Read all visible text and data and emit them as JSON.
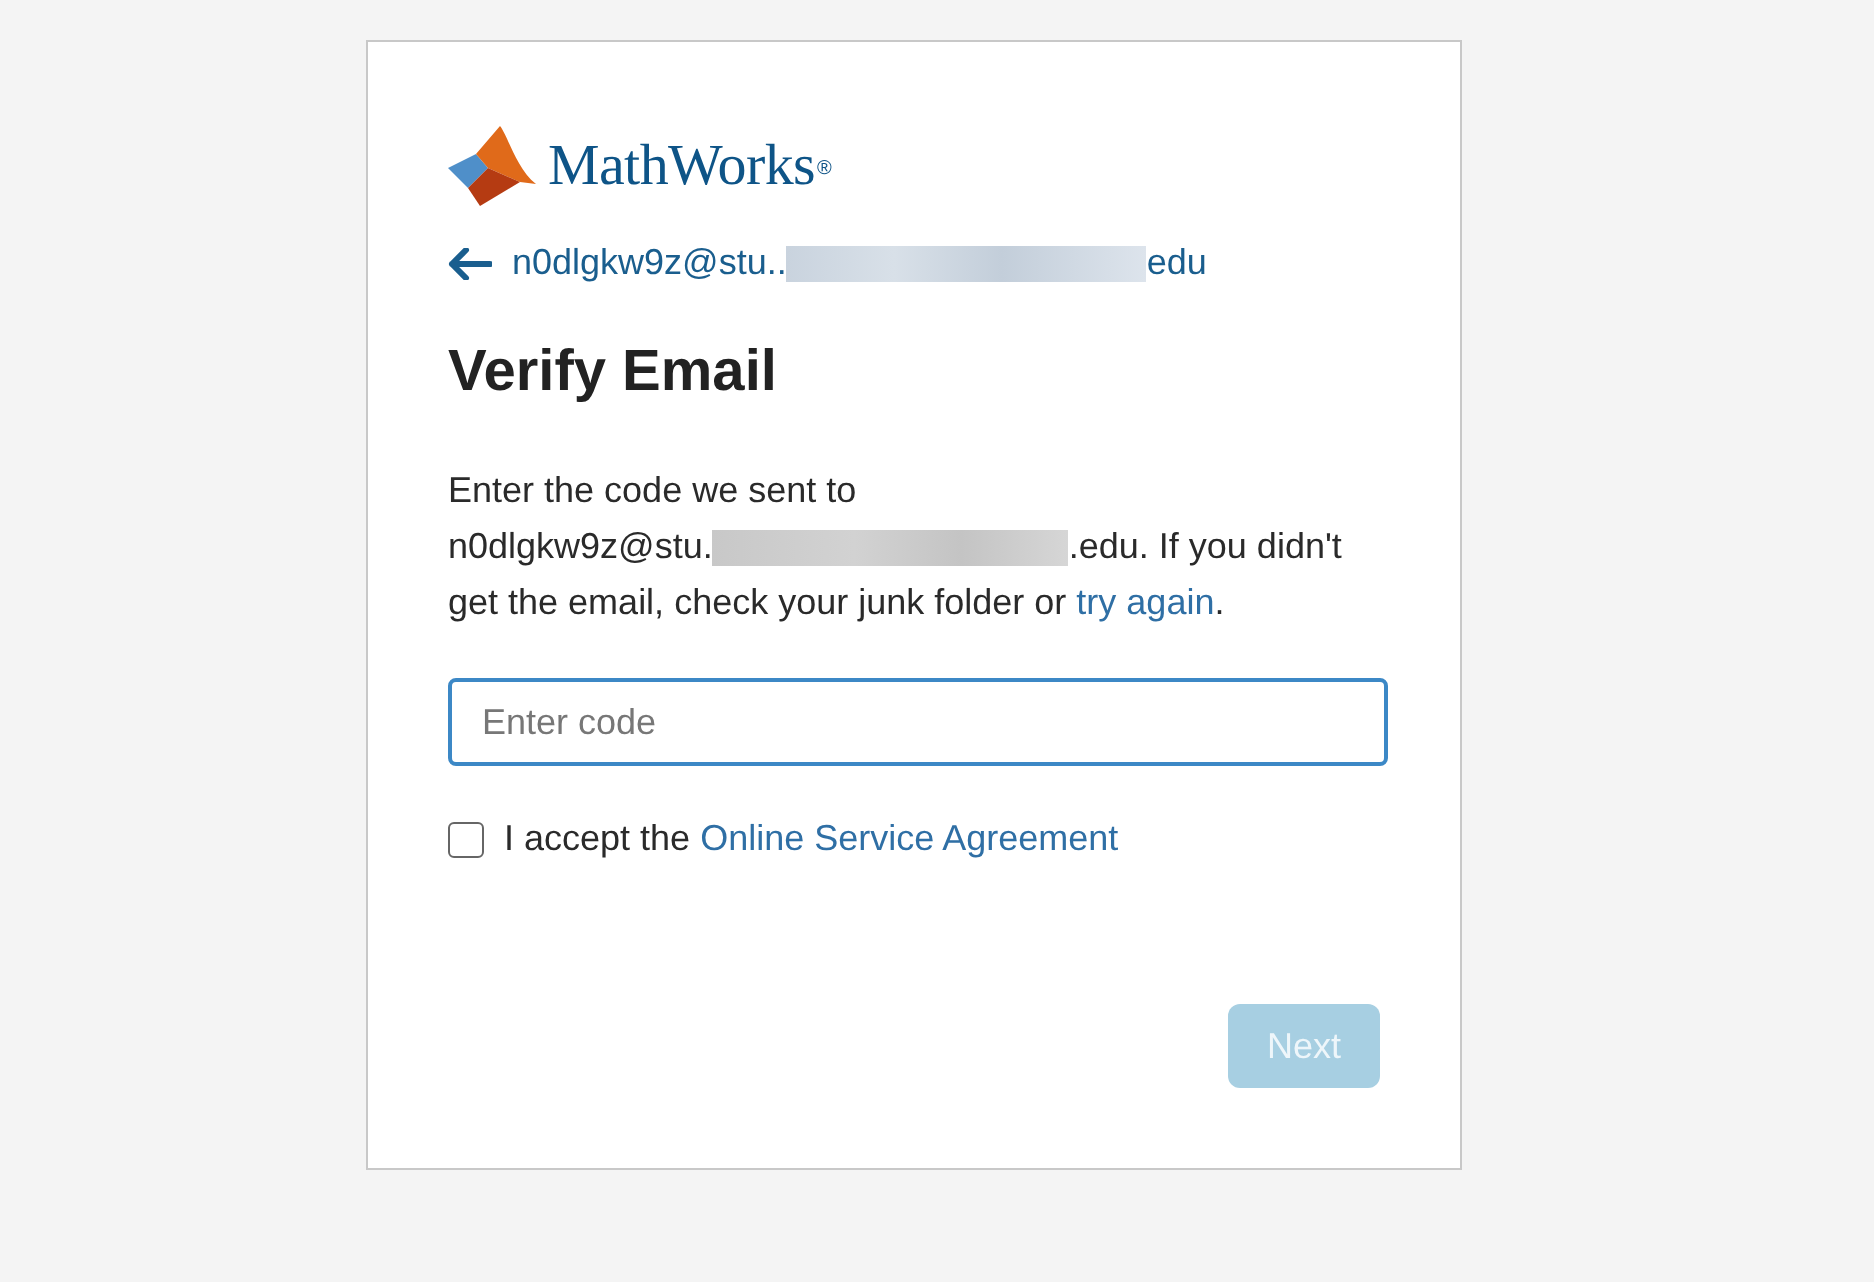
{
  "logo": {
    "wordmark": "MathWorks",
    "mark": "®"
  },
  "back_link": {
    "email_start": "n0dlgkw9z@stu..",
    "redacted": true,
    "email_end": "edu"
  },
  "title": "Verify Email",
  "instructions": {
    "lead": "Enter the code we sent to",
    "email_start": "n0dlgkw9z@stu.",
    "redacted": true,
    "email_end": ".edu.",
    "rest": "If you didn't get the email, check your junk folder or",
    "link": "try again",
    "end": "."
  },
  "code_field": {
    "placeholder": "Enter code",
    "focused": true
  },
  "agreement": {
    "checked": false,
    "text": "I accept the",
    "link": "Online Service Agreement"
  },
  "next_button": {
    "label": "Next",
    "disabled": true
  }
}
